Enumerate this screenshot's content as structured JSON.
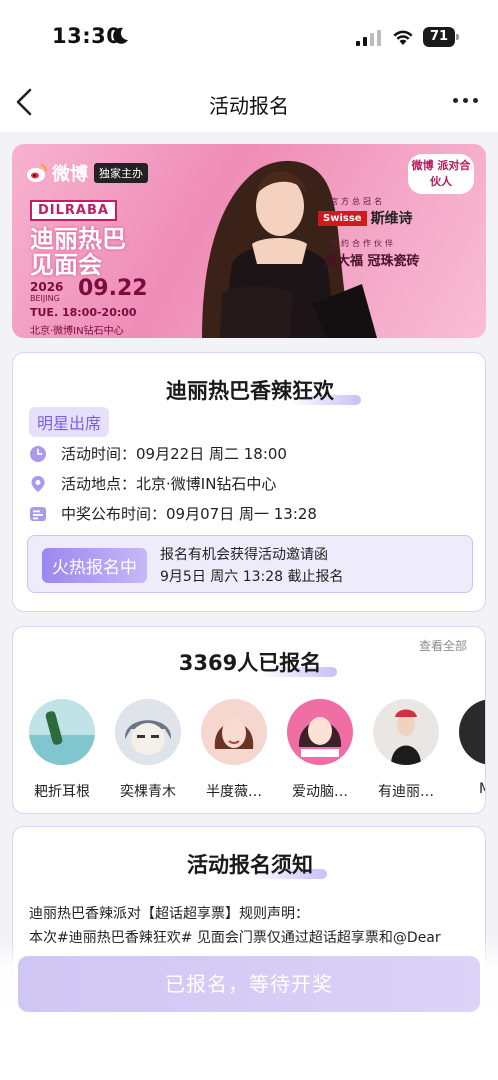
{
  "status_bar": {
    "time": "13:30",
    "battery": "71"
  },
  "nav": {
    "title": "活动报名"
  },
  "banner": {
    "weibo": "微博",
    "exclusive": "独家主办",
    "brand": "DILRABA",
    "name": "迪丽热巴见面会",
    "year": "2026",
    "city": "BEIJING",
    "date": "09.22",
    "time": "TUE. 18:00-20:00",
    "venue": "北京·微博IN钻石中心",
    "sponsor_label": "官方总冠名",
    "sponsor_brand": "Swisse",
    "sponsor_cn": "斯维诗",
    "partner_label": "特约合作伙伴",
    "partner": "周大福 冠珠瓷砖",
    "badge": "微博 派对合伙人"
  },
  "event": {
    "title": "迪丽热巴香辣狂欢",
    "badge": "明星出席",
    "rows": [
      {
        "label": "活动时间：",
        "value": "09月22日 周二 18:00"
      },
      {
        "label": "活动地点：",
        "value": "北京·微博IN钻石中心"
      },
      {
        "label": "中奖公布时间：",
        "value": "09月07日 周一 13:28"
      }
    ],
    "hot_button": "火热报名中",
    "hot_line1": "报名有机会获得活动邀请函",
    "hot_line2": "9月5日 周六 13:28 截止报名"
  },
  "registrants": {
    "count_title": "3369人已报名",
    "view_all": "查看全部",
    "users": [
      {
        "name": "耙折耳根"
      },
      {
        "name": "奕棵青木"
      },
      {
        "name": "半度薇…"
      },
      {
        "name": "爱动脑…"
      },
      {
        "name": "有迪丽…"
      },
      {
        "name": "Myr"
      }
    ]
  },
  "notice": {
    "title": "活动报名须知",
    "line1": "迪丽热巴香辣派对【超话超享票】规则声明：",
    "line2": "本次#迪丽热巴香辣狂欢# 见面会门票仅通过超话超享票和@Dear"
  },
  "bottom_button": "已报名，等待开奖",
  "colors": {
    "accent": "#8f7be8",
    "badge_bg": "#e6e0fb",
    "banner_pink": "#ef8cb6"
  }
}
